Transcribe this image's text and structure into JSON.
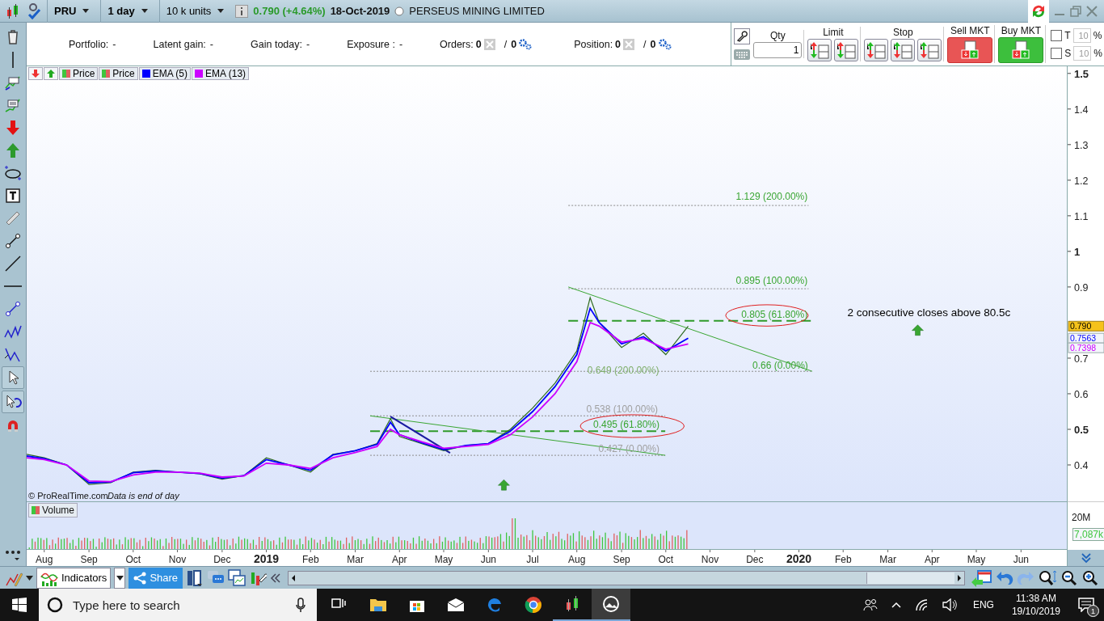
{
  "toolbar": {
    "symbol": "PRU",
    "interval": "1 day",
    "units": "10 k units",
    "quote": "0.790 (+4.64%)",
    "date": "18-Oct-2019",
    "instrument": "PERSEUS MINING LIMITED"
  },
  "account_bar": {
    "stats": [
      {
        "label": "Portfolio:",
        "value": "-"
      },
      {
        "label": "Latent gain:",
        "value": "-"
      },
      {
        "label": "Gain today:",
        "value": "-"
      },
      {
        "label": "Exposure :",
        "value": "-"
      }
    ],
    "counters": [
      {
        "label": "Orders:",
        "count": "0",
        "separator": "/",
        "pending": "0"
      },
      {
        "label": "Position:",
        "count": "0",
        "separator": "/",
        "pending": "0"
      }
    ]
  },
  "order_panel": {
    "qty_label": "Qty",
    "qty": "1",
    "limit_label": "Limit",
    "stop_label": "Stop",
    "sell_label": "Sell MKT",
    "buy_label": "Buy MKT",
    "options": [
      {
        "label": "T",
        "checked": false,
        "value": "10",
        "disabled": true,
        "unit": "%"
      },
      {
        "label": "S",
        "checked": false,
        "value": "10",
        "disabled": true,
        "unit": "%"
      }
    ]
  },
  "chart": {
    "legend": [
      {
        "label": "Price",
        "kind": "candle"
      },
      {
        "label": "Price",
        "kind": "candle"
      },
      {
        "label": "EMA (5)",
        "kind": "line",
        "color": "#0000ff"
      },
      {
        "label": "EMA (13)",
        "kind": "line",
        "color": "#cc00ff"
      }
    ],
    "credit": "© ProRealTime.com",
    "notice": "Data is end of day",
    "x_axis": [
      {
        "label": "Aug",
        "kind": "month"
      },
      {
        "label": "Sep",
        "kind": "month"
      },
      {
        "label": "Oct",
        "kind": "month"
      },
      {
        "label": "Nov",
        "kind": "month"
      },
      {
        "label": "Dec",
        "kind": "month"
      },
      {
        "label": "2019",
        "kind": "year"
      },
      {
        "label": "Feb",
        "kind": "month"
      },
      {
        "label": "Mar",
        "kind": "month"
      },
      {
        "label": "Apr",
        "kind": "month"
      },
      {
        "label": "May",
        "kind": "month"
      },
      {
        "label": "Jun",
        "kind": "month"
      },
      {
        "label": "Jul",
        "kind": "month"
      },
      {
        "label": "Aug",
        "kind": "month"
      },
      {
        "label": "Sep",
        "kind": "month"
      },
      {
        "label": "Oct",
        "kind": "month"
      },
      {
        "label": "Nov",
        "kind": "month"
      },
      {
        "label": "Dec",
        "kind": "month"
      },
      {
        "label": "2020",
        "kind": "year"
      },
      {
        "label": "Feb",
        "kind": "month"
      },
      {
        "label": "Mar",
        "kind": "month"
      },
      {
        "label": "Apr",
        "kind": "month"
      },
      {
        "label": "May",
        "kind": "month"
      },
      {
        "label": "Jun",
        "kind": "month"
      }
    ],
    "y_axis": [
      {
        "label": "1.5",
        "kind": "major"
      },
      {
        "label": "1.4",
        "kind": "minor"
      },
      {
        "label": "1.3",
        "kind": "minor"
      },
      {
        "label": "1.2",
        "kind": "minor"
      },
      {
        "label": "1.1",
        "kind": "minor"
      },
      {
        "label": "1",
        "kind": "major"
      },
      {
        "label": "0.9",
        "kind": "minor"
      },
      {
        "label": "0.7",
        "kind": "minor"
      },
      {
        "label": "0.6",
        "kind": "minor"
      },
      {
        "label": "0.5",
        "kind": "major"
      },
      {
        "label": "0.4",
        "kind": "minor"
      }
    ],
    "labels": [
      {
        "kind": "level",
        "text": "1.129 (200.00%)",
        "color": "#3aa632"
      },
      {
        "kind": "level",
        "text": "0.895 (100.00%)",
        "color": "#3aa632"
      },
      {
        "kind": "level",
        "text": "0.805 (61.80%)",
        "color": "#3aa632"
      },
      {
        "kind": "level",
        "text": "0.649 (200.00%)",
        "color": "#7fae6a"
      },
      {
        "kind": "level",
        "text": "0.66 (0.00%)",
        "color": "#3aa632"
      },
      {
        "kind": "level",
        "text": "0.538 (100.00%)",
        "color": "#a0a0a0"
      },
      {
        "kind": "level",
        "text": "0.495 (61.80%)",
        "color": "#3aa632"
      },
      {
        "kind": "level",
        "text": "0.427 (0.00%)",
        "color": "#a0a0a0"
      },
      {
        "kind": "note",
        "text": "2 consecutive closes above 80.5c",
        "color": "#000000"
      }
    ],
    "price_tags": [
      {
        "kind": "last_price",
        "text": "0.790",
        "color": "#f5c21b"
      },
      {
        "kind": "indicator",
        "text": "0.7563",
        "color": "#0000ff"
      },
      {
        "kind": "indicator",
        "text": "0.7398",
        "color": "#cc00ff"
      }
    ],
    "volume": {
      "label": "Volume",
      "axis_label": "20M",
      "current": "7,087k"
    }
  },
  "bottom_toolbar": {
    "indicators": "Indicators",
    "share": "Share"
  },
  "taskbar": {
    "search_placeholder": "Type here to search",
    "language": "ENG",
    "time": "11:38 AM",
    "date": "19/10/2019",
    "notifications": "1"
  }
}
